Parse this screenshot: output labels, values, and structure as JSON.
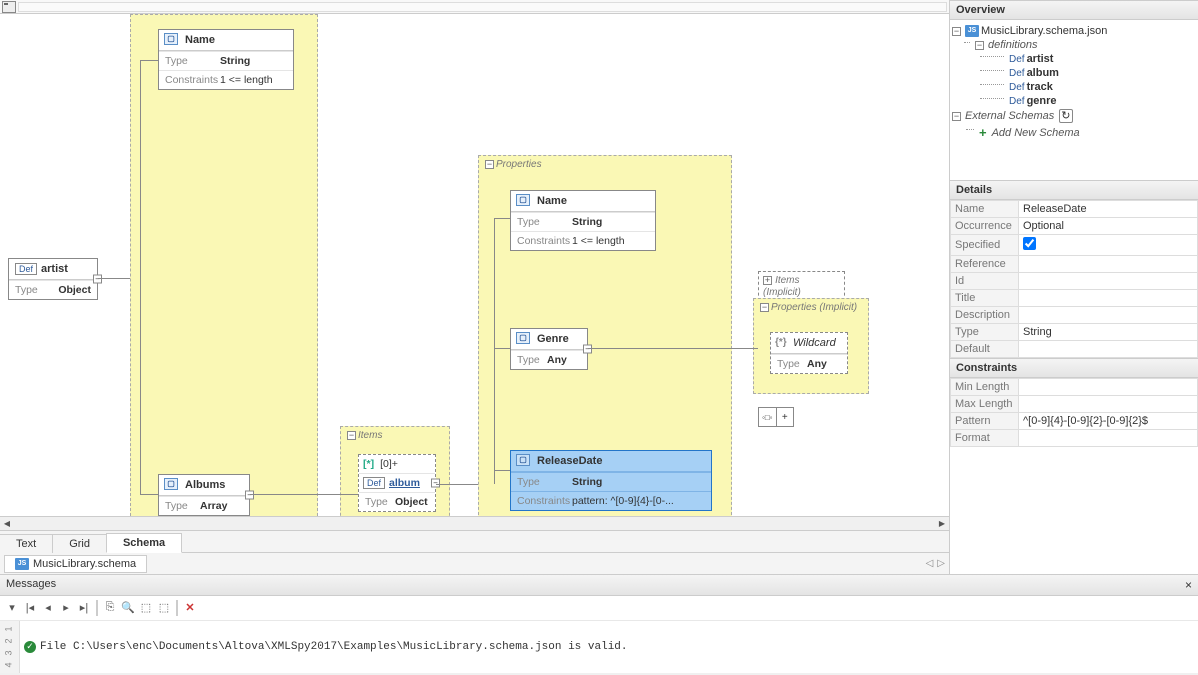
{
  "overview": {
    "title": "Overview",
    "root_file": "MusicLibrary.schema.json",
    "definitions_label": "definitions",
    "defs": [
      "artist",
      "album",
      "track",
      "genre"
    ],
    "external_label": "External Schemas",
    "add_new_label": "Add New Schema"
  },
  "details": {
    "title": "Details",
    "rows": {
      "Name": "ReleaseDate",
      "Occurrence": "Optional",
      "Specified": "checked",
      "Reference": "",
      "Id": "",
      "Title": "",
      "Description": "",
      "Type": "String",
      "Default": ""
    }
  },
  "constraints": {
    "title": "Constraints",
    "rows": {
      "Min Length": "",
      "Max Length": "",
      "Pattern": "^[0-9]{4}-[0-9]{2}-[0-9]{2}$",
      "Format": ""
    }
  },
  "canvas": {
    "artist": {
      "title": "artist",
      "type": "Object"
    },
    "name1": {
      "title": "Name",
      "type": "String",
      "constraints": "1 <= length"
    },
    "albums": {
      "title": "Albums",
      "type": "Array"
    },
    "items_group": "Items",
    "album_def": {
      "count": "[0]+",
      "ref": "album",
      "type": "Object"
    },
    "properties_group": "Properties",
    "name2": {
      "title": "Name",
      "type": "String",
      "constraints": "1 <= length"
    },
    "genre": {
      "title": "Genre",
      "type": "Any"
    },
    "release": {
      "title": "ReleaseDate",
      "type": "String",
      "constraints": "pattern: ^[0-9]{4}-[0-..."
    },
    "items_implicit": "Items (Implicit)",
    "props_implicit": "Properties (Implicit)",
    "wildcard": {
      "title": "Wildcard",
      "type": "Any"
    }
  },
  "view_tabs": [
    "Text",
    "Grid",
    "Schema"
  ],
  "active_view_tab": "Schema",
  "file_tab": "MusicLibrary.schema",
  "messages": {
    "title": "Messages",
    "content": "File C:\\Users\\enc\\Documents\\Altova\\XMLSpy2017\\Examples\\MusicLibrary.schema.json is valid."
  }
}
